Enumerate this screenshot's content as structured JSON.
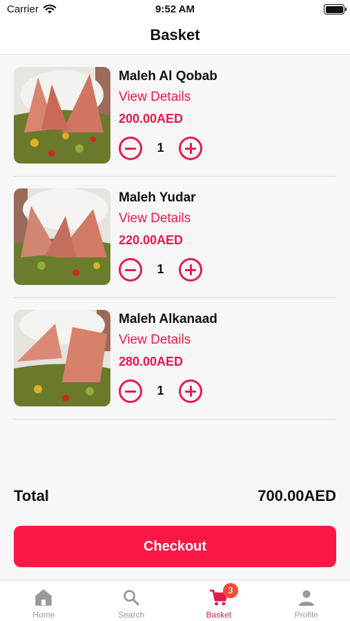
{
  "status_bar": {
    "carrier": "Carrier",
    "time": "9:52 AM"
  },
  "nav": {
    "title": "Basket"
  },
  "items": [
    {
      "name": "Maleh Al Qobab",
      "details_label": "View Details",
      "price": "200.00AED",
      "quantity": "1"
    },
    {
      "name": "Maleh Yudar",
      "details_label": "View Details",
      "price": "220.00AED",
      "quantity": "1"
    },
    {
      "name": "Maleh Alkanaad",
      "details_label": "View Details",
      "price": "280.00AED",
      "quantity": "1"
    }
  ],
  "summary": {
    "total_label": "Total",
    "total_value": "700.00AED"
  },
  "checkout": {
    "label": "Checkout"
  },
  "tabs": [
    {
      "label": "Home",
      "icon": "home-icon"
    },
    {
      "label": "Search",
      "icon": "search-icon"
    },
    {
      "label": "Basket",
      "icon": "cart-icon",
      "badge": "3",
      "active": true
    },
    {
      "label": "Profile",
      "icon": "person-icon"
    }
  ],
  "colors": {
    "accent": "#e8194a",
    "checkout": "#fb1846",
    "badge": "#f24a3a",
    "inactive_tab": "#999999"
  }
}
